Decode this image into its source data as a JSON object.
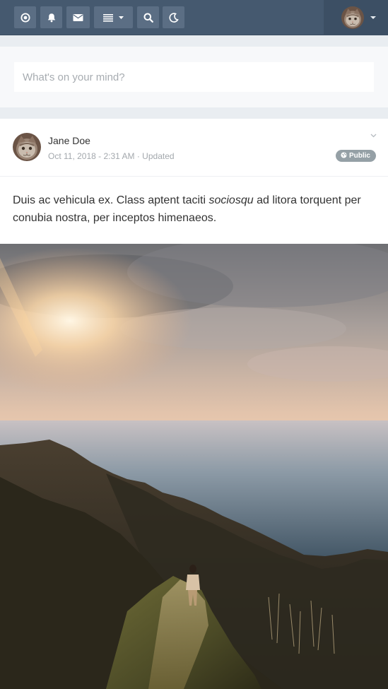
{
  "navbar": {
    "buttons": [
      {
        "icon": "target-icon"
      },
      {
        "icon": "bell-icon"
      },
      {
        "icon": "envelope-icon"
      },
      {
        "icon": "list-icon",
        "has_dropdown": true
      },
      {
        "icon": "search-icon"
      },
      {
        "icon": "moon-icon"
      }
    ],
    "user_menu": {
      "avatar": "cat-avatar",
      "has_dropdown": true
    },
    "colors": {
      "bar": "#45596f",
      "button": "#5b6e84",
      "user_area": "#3c4f64"
    }
  },
  "composer": {
    "placeholder": "What's on your mind?",
    "value": ""
  },
  "post": {
    "author": "Jane Doe",
    "meta": "Oct 11, 2018 - 2:31 AM · Updated",
    "privacy": "Public",
    "privacy_icon": "globe-icon",
    "menu_icon": "chevron-down-icon",
    "body_before": "Duis ac vehicula ex. Class aptent taciti ",
    "body_emphasis": "sociosqu",
    "body_after": " ad litora torquent per conubia nostra, per inceptos himenaeos.",
    "image": "sunset over mountain ridge and sea with hiker"
  }
}
